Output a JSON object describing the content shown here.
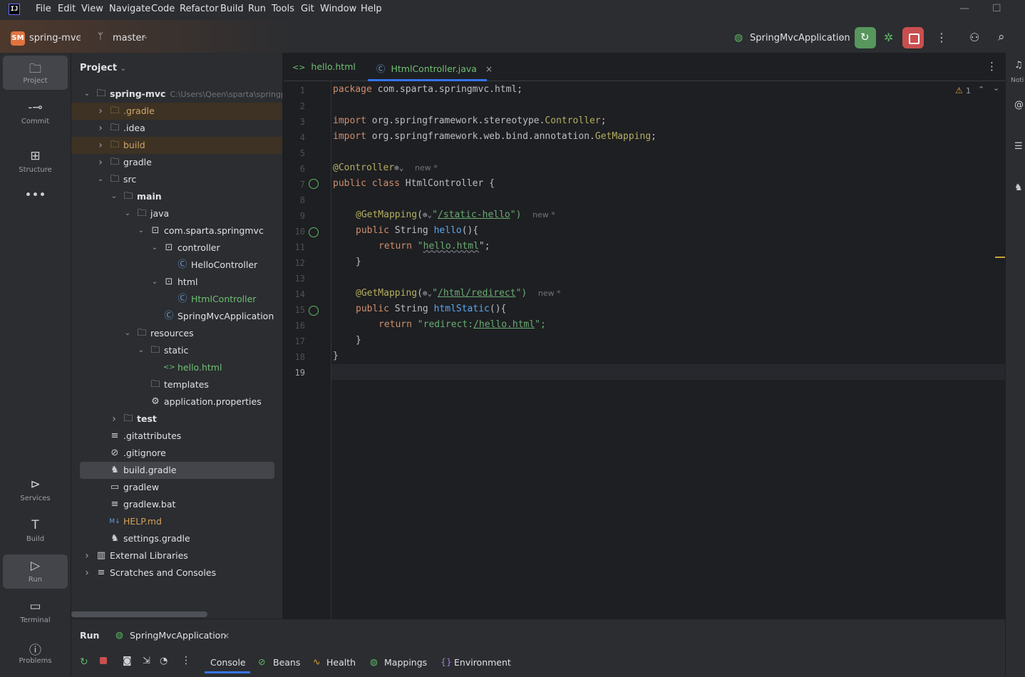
{
  "menubar": {
    "items": [
      "File",
      "Edit",
      "View",
      "Navigate",
      "Code",
      "Refactor",
      "Build",
      "Run",
      "Tools",
      "Git",
      "Window",
      "Help"
    ],
    "app_logo_text": "IJ"
  },
  "toolbar": {
    "project_badge": "SM",
    "project_name": "spring-mvc",
    "branch": "master",
    "run_config": "SpringMvcApplication"
  },
  "left_strip": {
    "items": [
      {
        "label": "Project",
        "icon": "folder-icon"
      },
      {
        "label": "Commit",
        "icon": "commit-icon"
      },
      {
        "label": "Structure",
        "icon": "structure-icon"
      },
      {
        "label": "Services",
        "icon": "services-icon"
      },
      {
        "label": "Build",
        "icon": "hammer-icon"
      },
      {
        "label": "Run",
        "icon": "run-icon"
      },
      {
        "label": "Terminal",
        "icon": "terminal-icon"
      },
      {
        "label": "Problems",
        "icon": "problems-icon"
      }
    ]
  },
  "project_panel": {
    "header": "Project",
    "root_path": "C:\\Users\\Qeen\\sparta\\springp",
    "tree": [
      {
        "name": "spring-mvc",
        "indent": 0,
        "arrow": "down",
        "icon": "module-folder-icon",
        "style": "bold"
      },
      {
        "name": ".gradle",
        "indent": 1,
        "arrow": "right",
        "icon": "folder-icon",
        "style": "excluded"
      },
      {
        "name": ".idea",
        "indent": 1,
        "arrow": "right",
        "icon": "folder-icon",
        "style": ""
      },
      {
        "name": "build",
        "indent": 1,
        "arrow": "right",
        "icon": "folder-icon",
        "style": "excluded"
      },
      {
        "name": "gradle",
        "indent": 1,
        "arrow": "right",
        "icon": "folder-icon",
        "style": ""
      },
      {
        "name": "src",
        "indent": 1,
        "arrow": "down",
        "icon": "folder-icon",
        "style": ""
      },
      {
        "name": "main",
        "indent": 2,
        "arrow": "down",
        "icon": "source-folder-icon",
        "style": "bold"
      },
      {
        "name": "java",
        "indent": 3,
        "arrow": "down",
        "icon": "java-folder-icon",
        "style": ""
      },
      {
        "name": "com.sparta.springmvc",
        "indent": 4,
        "arrow": "down",
        "icon": "package-icon",
        "style": ""
      },
      {
        "name": "controller",
        "indent": 5,
        "arrow": "down",
        "icon": "package-icon",
        "style": ""
      },
      {
        "name": "HelloController",
        "indent": 6,
        "arrow": "",
        "icon": "class-icon",
        "style": ""
      },
      {
        "name": "html",
        "indent": 5,
        "arrow": "down",
        "icon": "package-icon",
        "style": ""
      },
      {
        "name": "HtmlController",
        "indent": 6,
        "arrow": "",
        "icon": "class-icon",
        "style": "green"
      },
      {
        "name": "SpringMvcApplication",
        "indent": 5,
        "arrow": "",
        "icon": "spring-class-icon",
        "style": ""
      },
      {
        "name": "resources",
        "indent": 3,
        "arrow": "down",
        "icon": "resources-folder-icon",
        "style": ""
      },
      {
        "name": "static",
        "indent": 4,
        "arrow": "down",
        "icon": "folder-icon",
        "style": ""
      },
      {
        "name": "hello.html",
        "indent": 5,
        "arrow": "",
        "icon": "html-icon",
        "style": "green"
      },
      {
        "name": "templates",
        "indent": 4,
        "arrow": "",
        "icon": "folder-icon",
        "style": ""
      },
      {
        "name": "application.properties",
        "indent": 4,
        "arrow": "",
        "icon": "properties-icon",
        "style": ""
      },
      {
        "name": "test",
        "indent": 2,
        "arrow": "right",
        "icon": "source-folder-icon",
        "style": "bold"
      },
      {
        "name": ".gitattributes",
        "indent": 1,
        "arrow": "",
        "icon": "text-file-icon",
        "style": ""
      },
      {
        "name": ".gitignore",
        "indent": 1,
        "arrow": "",
        "icon": "ignore-file-icon",
        "style": ""
      },
      {
        "name": "build.gradle",
        "indent": 1,
        "arrow": "",
        "icon": "gradle-icon",
        "style": "selected"
      },
      {
        "name": "gradlew",
        "indent": 1,
        "arrow": "",
        "icon": "shell-icon",
        "style": ""
      },
      {
        "name": "gradlew.bat",
        "indent": 1,
        "arrow": "",
        "icon": "text-file-icon",
        "style": ""
      },
      {
        "name": "HELP.md",
        "indent": 1,
        "arrow": "",
        "icon": "markdown-icon",
        "style": "orange"
      },
      {
        "name": "settings.gradle",
        "indent": 1,
        "arrow": "",
        "icon": "gradle-icon",
        "style": ""
      },
      {
        "name": "External Libraries",
        "indent": 0,
        "arrow": "right",
        "icon": "library-icon",
        "style": ""
      },
      {
        "name": "Scratches and Consoles",
        "indent": 0,
        "arrow": "right",
        "icon": "scratch-icon",
        "style": ""
      }
    ]
  },
  "editor": {
    "tabs": [
      {
        "label": "hello.html",
        "icon": "html-icon"
      },
      {
        "label": "HtmlController.java",
        "icon": "class-icon",
        "active": true
      }
    ],
    "warning_count": "1",
    "line_numbers": [
      "1",
      "2",
      "3",
      "4",
      "5",
      "6",
      "7",
      "8",
      "9",
      "10",
      "11",
      "12",
      "13",
      "14",
      "15",
      "16",
      "17",
      "18",
      "19"
    ],
    "hint_new": "new *",
    "code": {
      "l1_kw": "package",
      "l1_rest": " com.sparta.springmvc.html;",
      "l3_kw": "import",
      "l3_rest": " org.springframework.stereotype.",
      "l3_ann": "Controller",
      "l3_end": ";",
      "l4_kw": "import",
      "l4_rest": " org.springframework.web.bind.annotation.",
      "l4_ann": "GetMapping",
      "l4_end": ";",
      "l6_ann": "@Controller",
      "l7_kw": "public class",
      "l7_rest": " HtmlController {",
      "l9_ann": "@GetMapping",
      "l9_paren": "(",
      "l9_q": "\"",
      "l9_path": "/static-hello",
      "l9_close": "\")",
      "l10_kw": "public",
      "l10_type": " String ",
      "l10_fn": "hello",
      "l10_rest": "(){",
      "l11_kw": "return",
      "l11_q": "\"",
      "l11_str": "hello.html",
      "l11_end": "\";",
      "l12": "}",
      "l14_ann": "@GetMapping",
      "l14_paren": "(",
      "l14_q": "\"",
      "l14_path": "/html/redirect",
      "l14_close": "\")",
      "l15_kw": "public",
      "l15_type": " String ",
      "l15_fn": "htmlStatic",
      "l15_rest": "(){",
      "l16_kw": "return",
      "l16_str1": "\"redirect:",
      "l16_path": "/hello.html",
      "l16_end": "\";",
      "l17": "}",
      "l18": "}"
    }
  },
  "right_strip": {
    "label": "Noti"
  },
  "run_panel": {
    "title": "Run",
    "config_tab": "SpringMvcApplication",
    "tabs": [
      "Console",
      "Beans",
      "Health",
      "Mappings",
      "Environment"
    ]
  }
}
